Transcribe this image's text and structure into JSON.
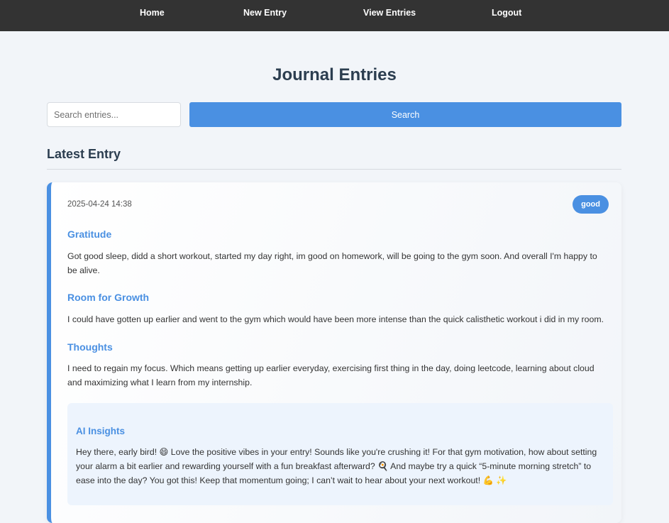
{
  "nav": {
    "home": "Home",
    "new_entry": "New Entry",
    "view_entries": "View Entries",
    "logout": "Logout"
  },
  "page": {
    "title": "Journal Entries"
  },
  "search": {
    "placeholder": "Search entries...",
    "value": "",
    "button_label": "Search"
  },
  "latest": {
    "heading": "Latest Entry",
    "entry": {
      "date": "2025-04-24 14:38",
      "mood": "good",
      "sections": [
        {
          "heading": "Gratitude",
          "text": "Got good sleep, didd a short workout, started my day right, im good on homework, will be going to the gym soon. And overall I'm happy to be alive."
        },
        {
          "heading": "Room for Growth",
          "text": "I could have gotten up earlier and went to the gym which would have been more intense than the quick calisthetic workout i did in my room."
        },
        {
          "heading": "Thoughts",
          "text": "I need to regain my focus. Which means getting up earlier everyday, exercising first thing in the day, doing leetcode, learning about cloud and maximizing what I learn from my internship."
        }
      ],
      "ai_insights": {
        "heading": "AI Insights",
        "text": "Hey there, early bird! 😄 Love the positive vibes in your entry! Sounds like you're crushing it! For that gym motivation, how about setting your alarm a bit earlier and rewarding yourself with a fun breakfast afterward? 🍳 And maybe try a quick “5-minute morning stretch” to ease into the day? You got this! Keep that momentum going; I can’t wait to hear about your next workout! 💪 ✨"
      }
    }
  },
  "colors": {
    "navbar_bg": "#333333",
    "accent": "#4a90e2",
    "page_bg": "#f2f5f9",
    "title_text": "#2c3e50",
    "ai_box_bg": "#edf4fd"
  }
}
